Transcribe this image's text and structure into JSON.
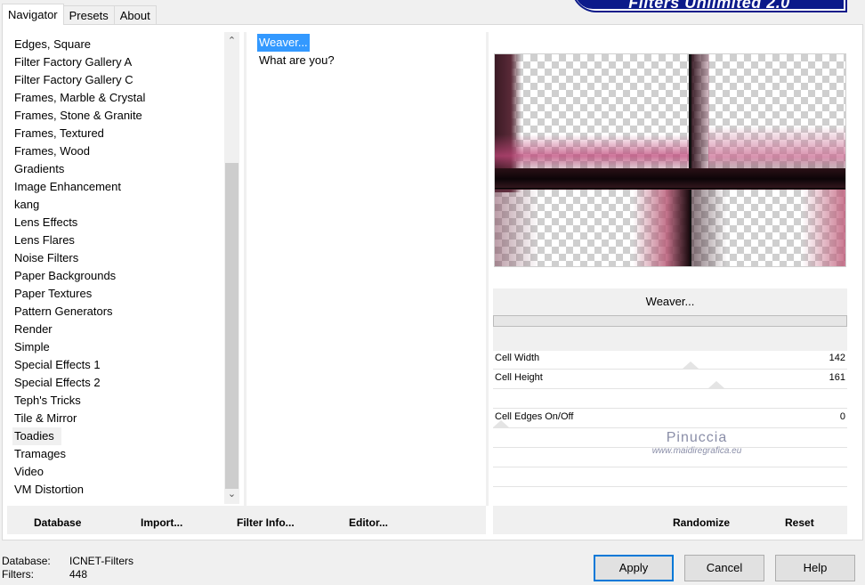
{
  "tabs": [
    {
      "label": "Navigator"
    },
    {
      "label": "Presets"
    },
    {
      "label": "About"
    }
  ],
  "logo_text": "Filters Unlimited 2.0",
  "categories": [
    "Edges, Square",
    "Filter Factory Gallery A",
    "Filter Factory Gallery C",
    "Frames, Marble & Crystal",
    "Frames, Stone & Granite",
    "Frames, Textured",
    "Frames, Wood",
    "Gradients",
    "Image Enhancement",
    "kang",
    "Lens Effects",
    "Lens Flares",
    "Noise Filters",
    "Paper Backgrounds",
    "Paper Textures",
    "Pattern Generators",
    "Render",
    "Simple",
    "Special Effects 1",
    "Special Effects 2",
    "Teph's Tricks",
    "Tile & Mirror",
    "Toadies",
    "Tramages",
    "Video",
    "VM Distortion"
  ],
  "selected_category": "Toadies",
  "filters": [
    "Weaver...",
    "What are you?"
  ],
  "selected_filter": "Weaver...",
  "filter_name": "Weaver...",
  "params": [
    {
      "label": "Cell Width",
      "value": "142"
    },
    {
      "label": "Cell Height",
      "value": "161"
    },
    {
      "label": "Cell Edges On/Off",
      "value": "0"
    }
  ],
  "watermark": {
    "line1": "Pinuccia",
    "line2": "www.maidiregrafica.eu"
  },
  "left_buttons": {
    "database": "Database",
    "import": "Import...",
    "filter_info": "Filter Info...",
    "editor": "Editor..."
  },
  "right_buttons": {
    "randomize": "Randomize",
    "reset": "Reset"
  },
  "status": {
    "database_label": "Database:",
    "database_value": "ICNET-Filters",
    "filters_label": "Filters:",
    "filters_value": "448"
  },
  "dialog_buttons": {
    "apply": "Apply",
    "cancel": "Cancel",
    "help": "Help"
  },
  "icons": {
    "scroll_up": "chevron-up-icon",
    "scroll_down": "chevron-down-icon"
  }
}
